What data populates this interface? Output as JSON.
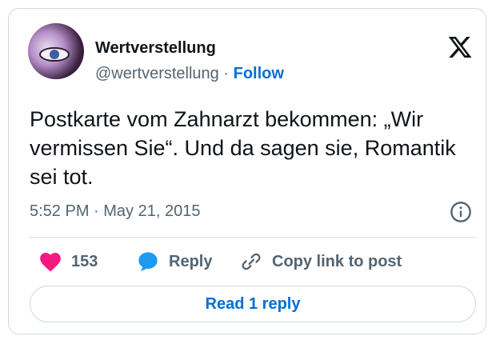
{
  "author": {
    "name": "Wertverstellung",
    "handle": "@wertverstellung",
    "separator": "·",
    "follow_label": "Follow",
    "avatar_icon": "avatar-portrait"
  },
  "brand": {
    "icon": "x-logo-icon"
  },
  "tweet": {
    "text": "Postkarte vom Zahnarzt bekommen: „Wir vermissen Sie“. Und da sagen sie, Romantik sei tot.",
    "timestamp": "5:52 PM · May 21, 2015"
  },
  "actions": {
    "like_count": "153",
    "reply_label": "Reply",
    "copy_label": "Copy link to post"
  },
  "read_replies_label": "Read 1 reply",
  "colors": {
    "accent": "#006fd6",
    "like": "#f91880",
    "reply_bubble": "#1d9bf0",
    "muted": "#536471",
    "border": "#cfd9de"
  }
}
